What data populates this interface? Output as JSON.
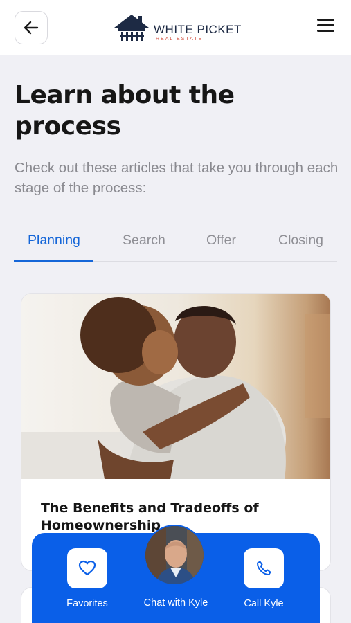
{
  "header": {
    "brand_name": "WHITE PICKET",
    "brand_tagline": "REAL ESTATE",
    "icons": [
      "arrow-left-icon",
      "house-logo-icon",
      "hamburger-menu-icon"
    ]
  },
  "main": {
    "title": "Learn about the process",
    "subtitle": "Check out these articles that take you through each stage of the process:",
    "tabs": [
      {
        "label": "Planning",
        "active": true
      },
      {
        "label": "Search",
        "active": false
      },
      {
        "label": "Offer",
        "active": false
      },
      {
        "label": "Closing",
        "active": false
      }
    ],
    "articles": [
      {
        "title": "The Benefits and Tradeoffs of Homeownership"
      }
    ]
  },
  "action_bar": {
    "favorites_label": "Favorites",
    "chat_label": "Chat with Kyle",
    "call_label": "Call Kyle"
  },
  "colors": {
    "accent": "#1566d8",
    "action_bar": "#0a5fe8",
    "background": "#f0f0f5",
    "brand_navy": "#1d2a44",
    "brand_red": "#d04a3a"
  }
}
